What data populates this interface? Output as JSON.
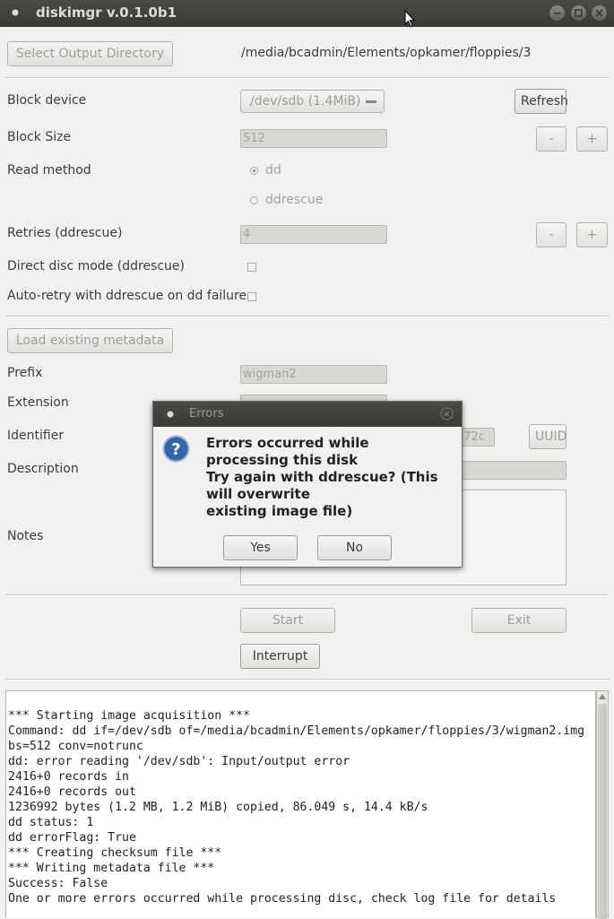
{
  "window": {
    "title": "diskimgr v.0.1.0b1"
  },
  "output": {
    "select_label": "Select Output Directory",
    "path": "/media/bcadmin/Elements/opkamer/floppies/3"
  },
  "form": {
    "block_device_label": "Block device",
    "block_device_value": "/dev/sdb (1.4MiB)",
    "refresh_label": "Refresh",
    "block_size_label": "Block Size",
    "block_size_value": "512",
    "minus": "-",
    "plus": "+",
    "read_method_label": "Read method",
    "read_method_options": [
      "dd",
      "ddrescue"
    ],
    "retries_label": "Retries (ddrescue)",
    "retries_value": "4",
    "direct_disc_label": "Direct disc mode (ddrescue)",
    "auto_retry_label": "Auto-retry with ddrescue on dd failure"
  },
  "metadata": {
    "load_label": "Load existing metadata",
    "prefix_label": "Prefix",
    "prefix_value": "wigman2",
    "extension_label": "Extension",
    "identifier_label": "Identifier",
    "identifier_visible": "72c",
    "uuid_label": "UUID",
    "description_label": "Description",
    "notes_label": "Notes"
  },
  "actions": {
    "start_label": "Start",
    "exit_label": "Exit",
    "interrupt_label": "Interrupt"
  },
  "log": {
    "lines": [
      "*** Starting image acquisition ***",
      "Command: dd if=/dev/sdb of=/media/bcadmin/Elements/opkamer/floppies/3/wigman2.img",
      "bs=512 conv=notrunc",
      "dd: error reading '/dev/sdb': Input/output error",
      "2416+0 records in",
      "2416+0 records out",
      "1236992 bytes (1.2 MB, 1.2 MiB) copied, 86.049 s, 14.4 kB/s",
      "dd status: 1",
      "dd errorFlag: True",
      "*** Creating checksum file ***",
      "*** Writing metadata file ***",
      "Success: False",
      "One or more errors occurred while processing disc, check log file for details"
    ]
  },
  "dialog": {
    "title": "Errors",
    "message_lines": [
      "Errors occurred while",
      "processing this disk",
      "Try again with ddrescue? (This",
      "will overwrite",
      "existing image file)"
    ],
    "yes_label": "Yes",
    "no_label": "No"
  }
}
